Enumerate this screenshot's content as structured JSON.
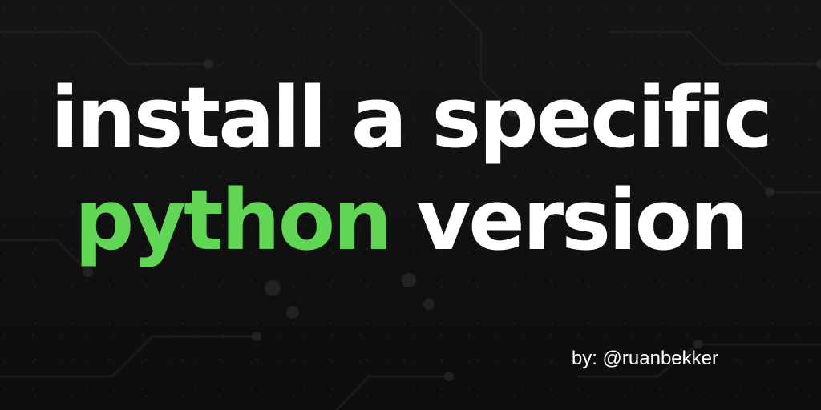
{
  "headline": {
    "line1": "install a specific",
    "line2_accent": "python",
    "line2_rest": "version"
  },
  "byline": "by: @ruanbekker",
  "colors": {
    "background": "#111111",
    "text": "#ffffff",
    "accent": "#61d655"
  },
  "decoration": "circuit-board-background"
}
